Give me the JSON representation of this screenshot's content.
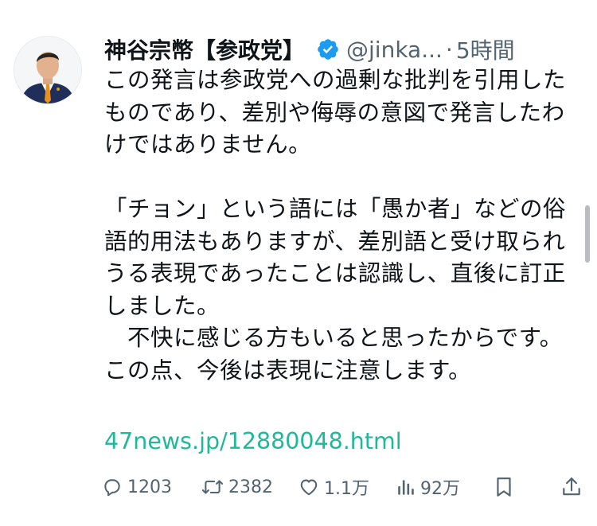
{
  "tweet": {
    "author": {
      "display_name": "神谷宗幣【参政党】",
      "handle": "@jinka...",
      "verified": true
    },
    "separator": "·",
    "timestamp": "5時間",
    "body": "この発言は参政党への過剰な批判を引用した\nものであり、差別や侮辱の意図で発言したわ\nけではありません。\n\n「チョン」という語には「愚か者」などの俗\n語的用法もありますが、差別語と受け取られ\nうる表現であったことは認識し、直後に訂正\nしました。\n　不快に感じる方もいると思ったからです。\nこの点、今後は表現に注意します。",
    "link": "47news.jp/12880048.html",
    "actions": {
      "replies": "1203",
      "reposts": "2382",
      "likes": "1.1万",
      "views": "92万"
    }
  },
  "colors": {
    "text": "#0f1419",
    "secondary": "#536471",
    "link": "#1fb89a",
    "verified": "#1d9bf0",
    "scrollbar": "#b9bcc0"
  },
  "icons": {
    "reply": "speech-bubble-icon",
    "repost": "repost-arrows-icon",
    "like": "heart-icon",
    "views": "bar-chart-icon",
    "bookmark": "bookmark-icon",
    "share": "share-upload-icon",
    "verified": "verified-badge-icon"
  }
}
